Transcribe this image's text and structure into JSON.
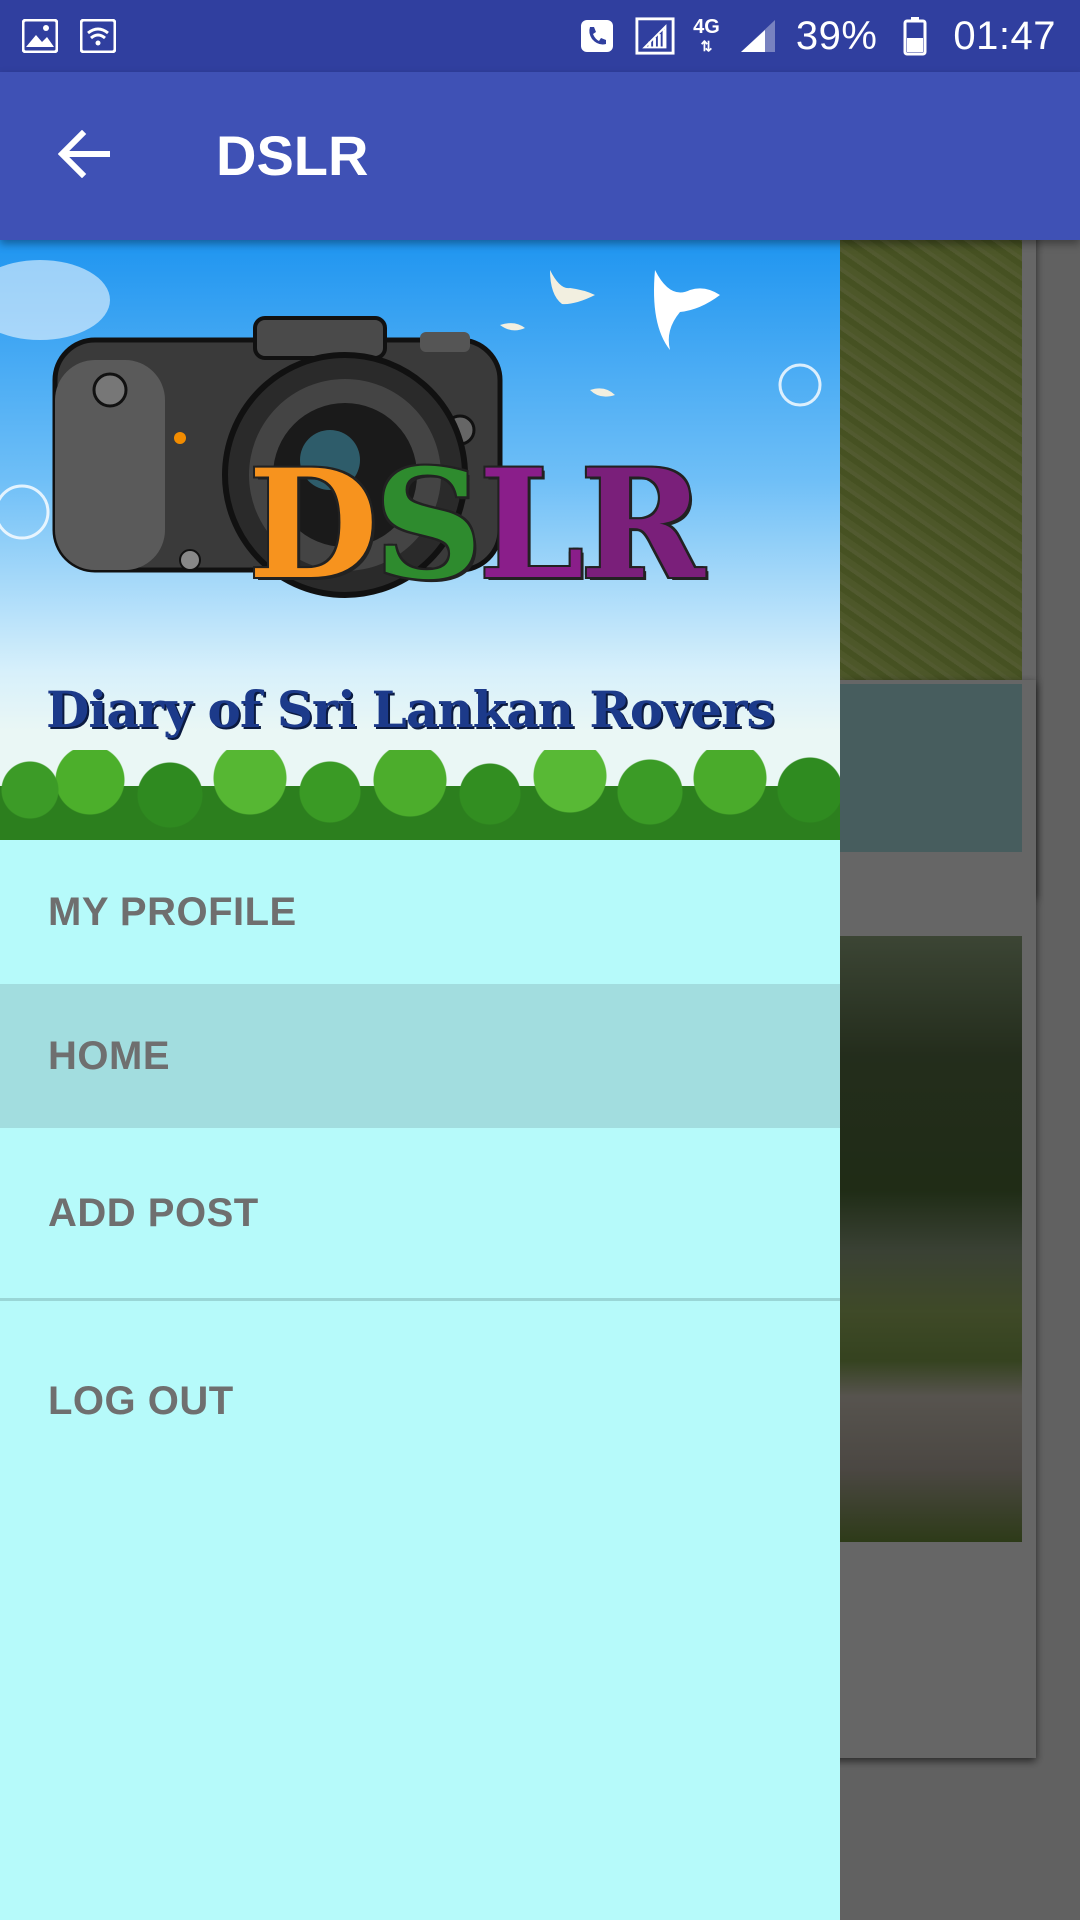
{
  "status_bar": {
    "network_type": "4G",
    "battery": "39%",
    "time": "01:47",
    "icons": [
      "gallery-icon",
      "wifi-hotspot-icon",
      "call-icon",
      "signal-sim-icon",
      "network-4g-icon",
      "signal-bars-icon",
      "battery-icon"
    ]
  },
  "app_bar": {
    "title": "DSLR",
    "back_icon": "arrow-back-icon"
  },
  "drawer": {
    "header": {
      "logo": "DSLR",
      "tagline": "Diary of Sri Lankan Rovers"
    },
    "items": [
      {
        "label": "MY PROFILE",
        "active": false
      },
      {
        "label": "HOME",
        "active": true
      },
      {
        "label": "ADD POST",
        "active": false
      },
      {
        "label": "LOG OUT",
        "active": false
      }
    ]
  },
  "colors": {
    "status_bar": "#303f9f",
    "app_bar": "#3f51b5",
    "drawer_bg": "#b6fafa",
    "active_item": "#a2dddf",
    "item_text": "#6f6f6f"
  }
}
